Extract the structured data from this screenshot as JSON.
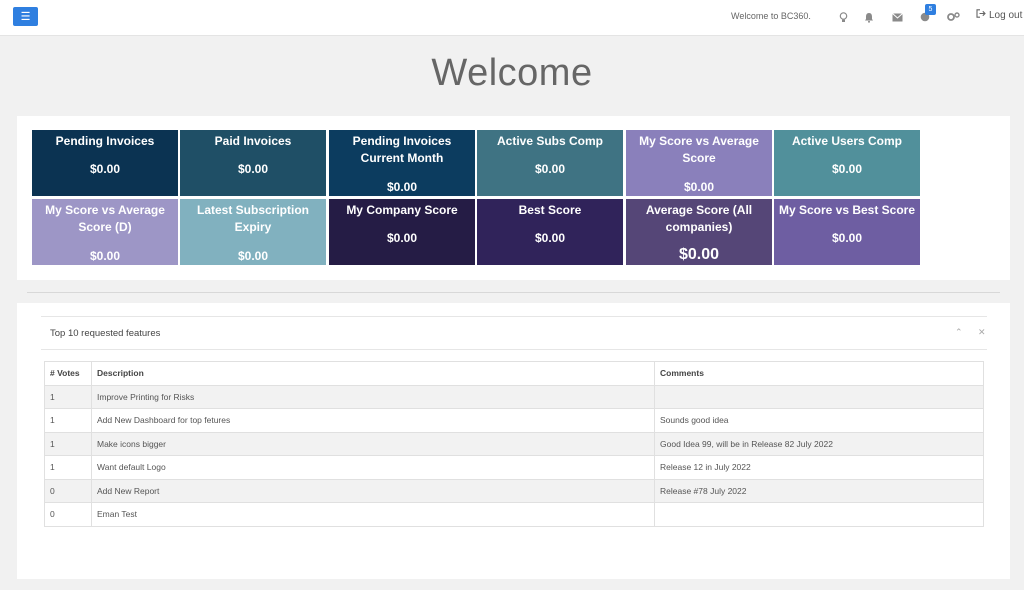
{
  "header": {
    "welcome": "Welcome to BC360.",
    "notification_count": "5",
    "logout_label": "Log out"
  },
  "page": {
    "title": "Welcome"
  },
  "tiles": [
    {
      "title": "Pending Invoices",
      "value": "$0.00",
      "color": "#0b3352"
    },
    {
      "title": "Paid Invoices",
      "value": "$0.00",
      "color": "#1f4f66"
    },
    {
      "title": "Pending Invoices Current Month",
      "value": "$0.00",
      "color": "#0c3c5f"
    },
    {
      "title": "Active Subs Comp",
      "value": "$0.00",
      "color": "#3f7383"
    },
    {
      "title": "My Score vs Average Score",
      "value": "$0.00",
      "color": "#8a80bb"
    },
    {
      "title": "Active Users Comp",
      "value": "$0.00",
      "color": "#51909b"
    },
    {
      "title": "My Score vs Average Score (D)",
      "value": "$0.00",
      "color": "#9d96c6"
    },
    {
      "title": "Latest Subscription Expiry",
      "value": "$0.00",
      "color": "#81b1bf"
    },
    {
      "title": "My Company Score",
      "value": "$0.00",
      "color": "#251c45"
    },
    {
      "title": "Best Score",
      "value": "$0.00",
      "color": "#30235a"
    },
    {
      "title": "Average Score (All companies)",
      "value": "$0.00",
      "color": "#554677"
    },
    {
      "title": "My Score vs Best Score",
      "value": "$0.00",
      "color": "#6e5ea2"
    }
  ],
  "features": {
    "title": "Top 10 requested features",
    "columns": [
      "# Votes",
      "Description",
      "Comments"
    ],
    "rows": [
      {
        "votes": "1",
        "description": "Improve Printing for Risks",
        "comments": ""
      },
      {
        "votes": "1",
        "description": "Add New Dashboard for top fetures",
        "comments": "Sounds good idea"
      },
      {
        "votes": "1",
        "description": "Make icons bigger",
        "comments": "Good Idea 99, will be in Release 82 July 2022"
      },
      {
        "votes": "1",
        "description": "Want default Logo",
        "comments": "Release 12 in July 2022"
      },
      {
        "votes": "0",
        "description": "Add New Report",
        "comments": "Release #78 July 2022"
      },
      {
        "votes": "0",
        "description": "Eman Test",
        "comments": ""
      }
    ]
  }
}
